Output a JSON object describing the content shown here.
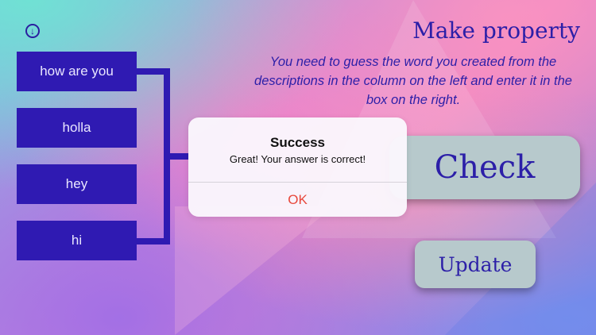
{
  "header": {
    "download_icon": "arrow-down-circle-icon",
    "title": "Make property",
    "description": "You need to guess the word you created from the descriptions in the column on the left and enter it in the box on the right."
  },
  "words": [
    "how are you",
    "holla",
    "hey",
    "hi"
  ],
  "buttons": {
    "check_label": "Check",
    "update_label": "Update"
  },
  "alert": {
    "title": "Success",
    "message": "Great! Your answer is correct!",
    "ok_label": "OK"
  },
  "colors": {
    "word_box": "#2f1ab2",
    "title_text": "#2c1fa8",
    "button_bg": "#b7c9cc",
    "alert_ok": "#e8473b"
  }
}
